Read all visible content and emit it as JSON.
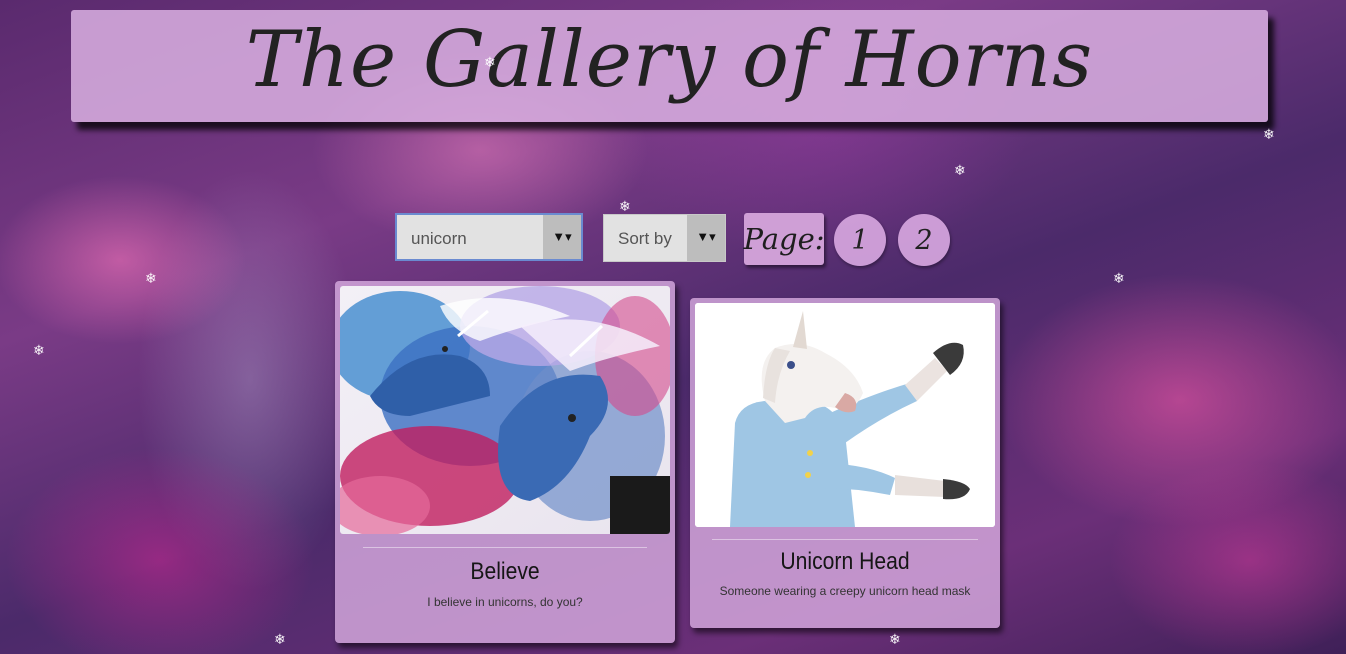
{
  "banner": {
    "title": "The Gallery of Horns"
  },
  "filters": {
    "keyword_select": {
      "value": "unicorn"
    },
    "sort_select": {
      "value": "Sort by"
    },
    "dropdown_arrow": "▼▾"
  },
  "pagination": {
    "label": "Page:",
    "pages": [
      "1",
      "2"
    ]
  },
  "gallery": [
    {
      "title": "Believe",
      "description": "I believe in unicorns, do you?"
    },
    {
      "title": "Unicorn Head",
      "description": "Someone wearing a creepy unicorn head mask"
    }
  ],
  "decor": {
    "snowflake": "❄"
  }
}
